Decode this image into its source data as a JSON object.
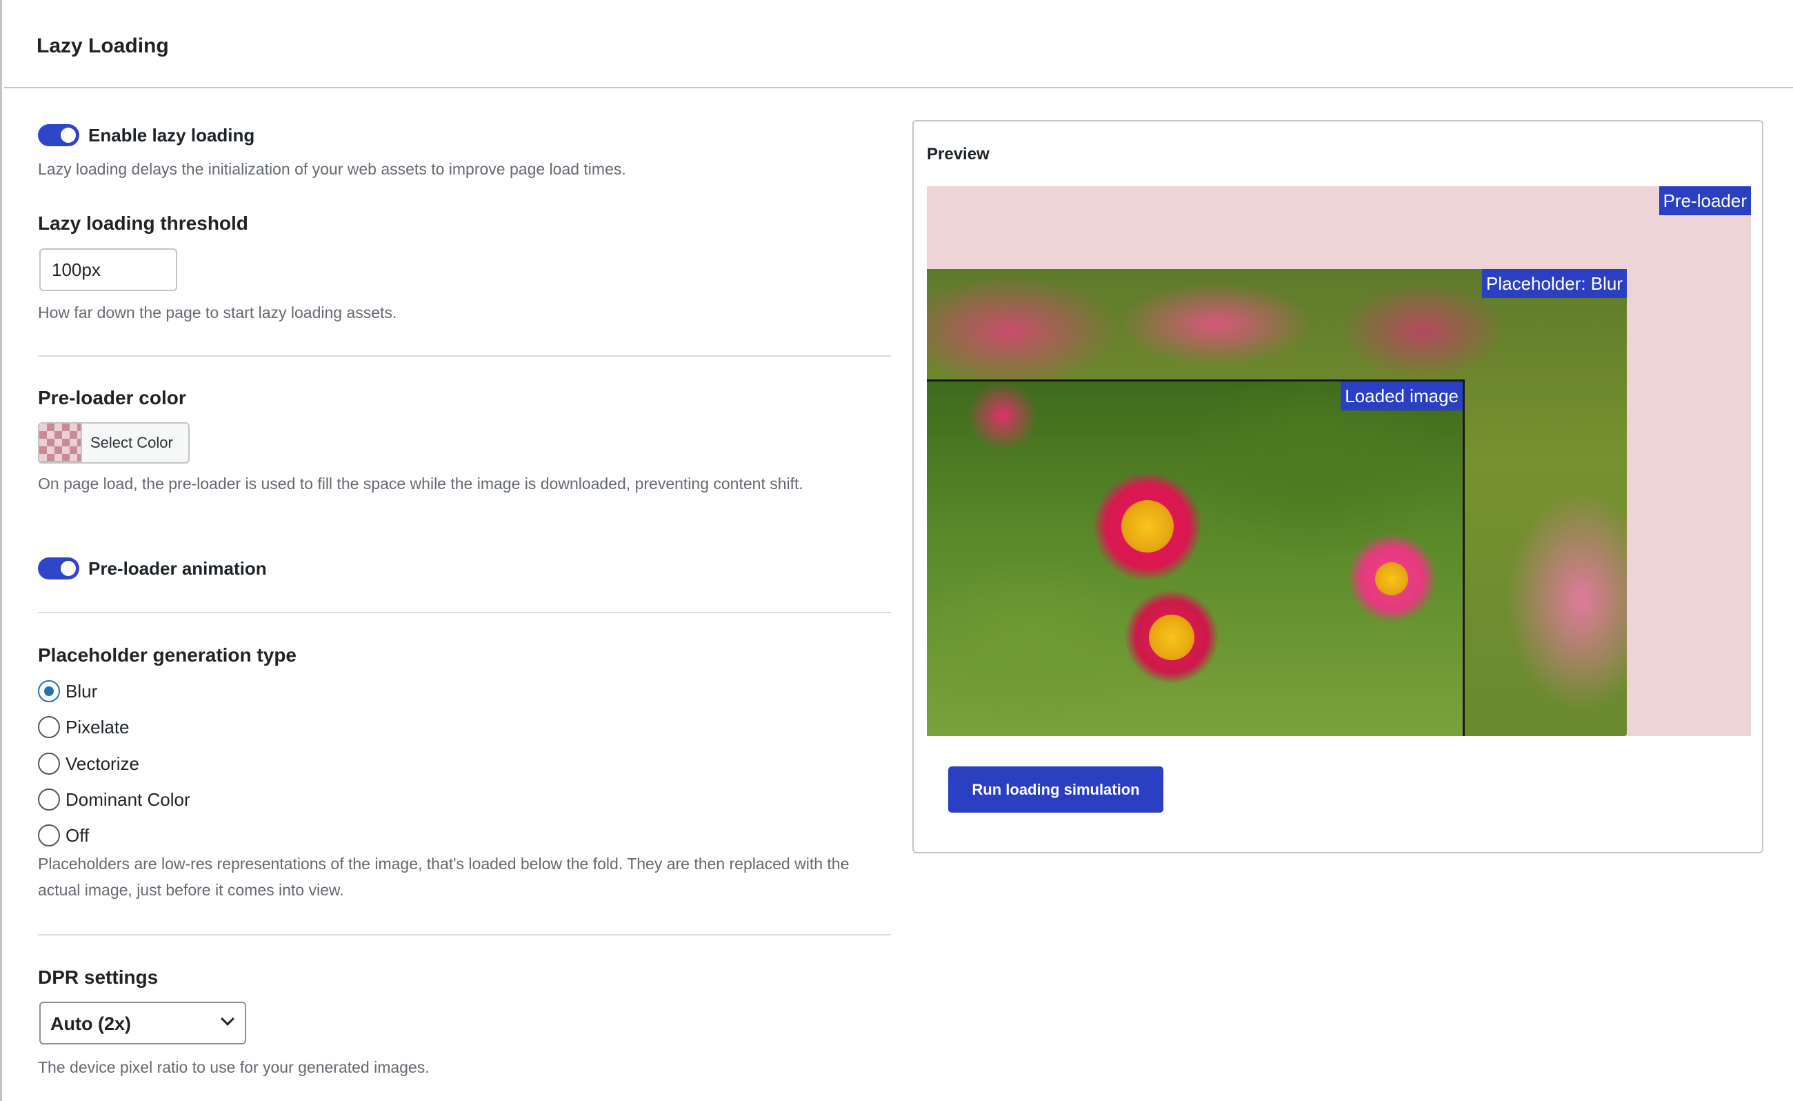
{
  "page": {
    "title": "Lazy Loading"
  },
  "settings": {
    "enable_lazy_loading": {
      "label": "Enable lazy loading",
      "enabled": true,
      "help": "Lazy loading delays the initialization of your web assets to improve page load times."
    },
    "threshold": {
      "title": "Lazy loading threshold",
      "value": "100px",
      "help": "How far down the page to start lazy loading assets."
    },
    "preloader_color": {
      "title": "Pre-loader color",
      "button_label": "Select Color",
      "help": "On page load, the pre-loader is used to fill the space while the image is downloaded, preventing content shift."
    },
    "preloader_animation": {
      "label": "Pre-loader animation",
      "enabled": true
    },
    "placeholder_type": {
      "title": "Placeholder generation type",
      "options": [
        "Blur",
        "Pixelate",
        "Vectorize",
        "Dominant Color",
        "Off"
      ],
      "selected": "Blur",
      "help": "Placeholders are low-res representations of the image, that's loaded below the fold. They are then replaced with the actual image, just before it comes into view."
    },
    "dpr": {
      "title": "DPR settings",
      "selected": "Auto (2x)",
      "help": "The device pixel ratio to use for your generated images."
    }
  },
  "preview": {
    "title": "Preview",
    "preloader_tag": "Pre-loader",
    "placeholder_tag": "Placeholder: Blur",
    "loaded_tag": "Loaded image",
    "run_button": "Run loading simulation"
  },
  "colors": {
    "accent": "#2b3fc2",
    "preloader": "#ecd4d7",
    "radio_selected": "#2271b1"
  }
}
